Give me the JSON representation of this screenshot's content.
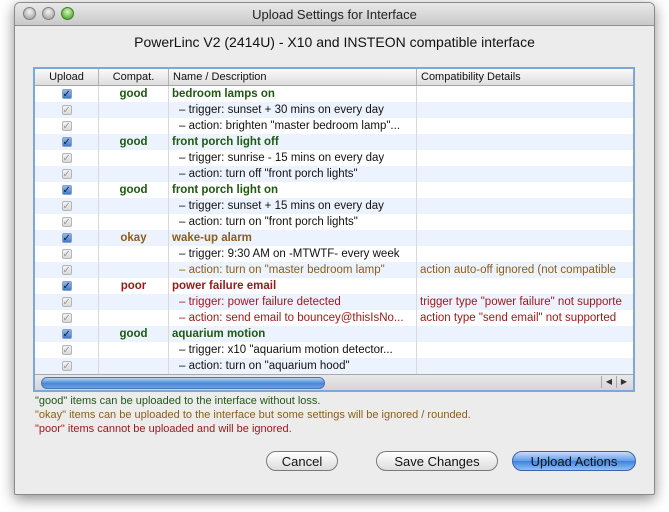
{
  "window": {
    "title": "Upload Settings for Interface"
  },
  "device_name": "PowerLinc V2 (2414U) - X10 and INSTEON compatible interface",
  "table": {
    "headers": [
      "Upload",
      "Compat.",
      "Name / Description",
      "Compatibility Details"
    ],
    "rows": [
      {
        "checked": true,
        "dim": false,
        "compat": "good",
        "name": "bedroom lamps on",
        "details": "",
        "kind": "good"
      },
      {
        "checked": true,
        "dim": true,
        "compat": "",
        "name": "–  trigger: sunset + 30 mins on every day",
        "details": "",
        "kind": "plain"
      },
      {
        "checked": true,
        "dim": true,
        "compat": "",
        "name": "–  action: brighten \"master bedroom lamp\"...",
        "details": "",
        "kind": "plain"
      },
      {
        "checked": true,
        "dim": false,
        "compat": "good",
        "name": "front porch light off",
        "details": "",
        "kind": "good"
      },
      {
        "checked": true,
        "dim": true,
        "compat": "",
        "name": "–  trigger: sunrise - 15 mins on every day",
        "details": "",
        "kind": "plain"
      },
      {
        "checked": true,
        "dim": true,
        "compat": "",
        "name": "–  action: turn off \"front porch lights\"",
        "details": "",
        "kind": "plain"
      },
      {
        "checked": true,
        "dim": false,
        "compat": "good",
        "name": "front porch light on",
        "details": "",
        "kind": "good"
      },
      {
        "checked": true,
        "dim": true,
        "compat": "",
        "name": "–  trigger: sunset + 15 mins on every day",
        "details": "",
        "kind": "plain"
      },
      {
        "checked": true,
        "dim": true,
        "compat": "",
        "name": "–  action: turn on \"front porch lights\"",
        "details": "",
        "kind": "plain"
      },
      {
        "checked": true,
        "dim": false,
        "compat": "okay",
        "name": "wake-up alarm",
        "details": "",
        "kind": "okay"
      },
      {
        "checked": true,
        "dim": true,
        "compat": "",
        "name": "–  trigger: 9:30 AM on -MTWTF- every week",
        "details": "",
        "kind": "plain"
      },
      {
        "checked": true,
        "dim": true,
        "compat": "",
        "name": "–  action: turn on \"master bedroom lamp\"",
        "details": "action auto-off ignored (not compatible",
        "kind": "okay"
      },
      {
        "checked": true,
        "dim": false,
        "compat": "poor",
        "name": "power failure email",
        "details": "",
        "kind": "poor"
      },
      {
        "checked": true,
        "dim": true,
        "compat": "",
        "name": "–  trigger: power failure detected",
        "details": "trigger type \"power failure\" not supporte",
        "kind": "poor"
      },
      {
        "checked": true,
        "dim": true,
        "compat": "",
        "name": "–  action: send email to bouncey@thisIsNo...",
        "details": "action type \"send email\" not supported",
        "kind": "poor"
      },
      {
        "checked": true,
        "dim": false,
        "compat": "good",
        "name": "aquarium motion",
        "details": "",
        "kind": "good"
      },
      {
        "checked": true,
        "dim": true,
        "compat": "",
        "name": "–  trigger: x10 \"aquarium motion detector...",
        "details": "",
        "kind": "plain"
      },
      {
        "checked": true,
        "dim": true,
        "compat": "",
        "name": "–  action: turn on \"aquarium hood\"",
        "details": "",
        "kind": "plain"
      }
    ]
  },
  "legend": {
    "good": "\"good\" items can be uploaded to the interface without loss.",
    "okay": "\"okay\" items can be uploaded to the interface but some settings will be ignored / rounded.",
    "poor": "\"poor\" items cannot be uploaded and will be ignored."
  },
  "buttons": {
    "cancel": "Cancel",
    "save": "Save Changes",
    "upload": "Upload Actions"
  },
  "scrollbar": {
    "left_arrow": "◀",
    "right_arrow": "▶"
  }
}
